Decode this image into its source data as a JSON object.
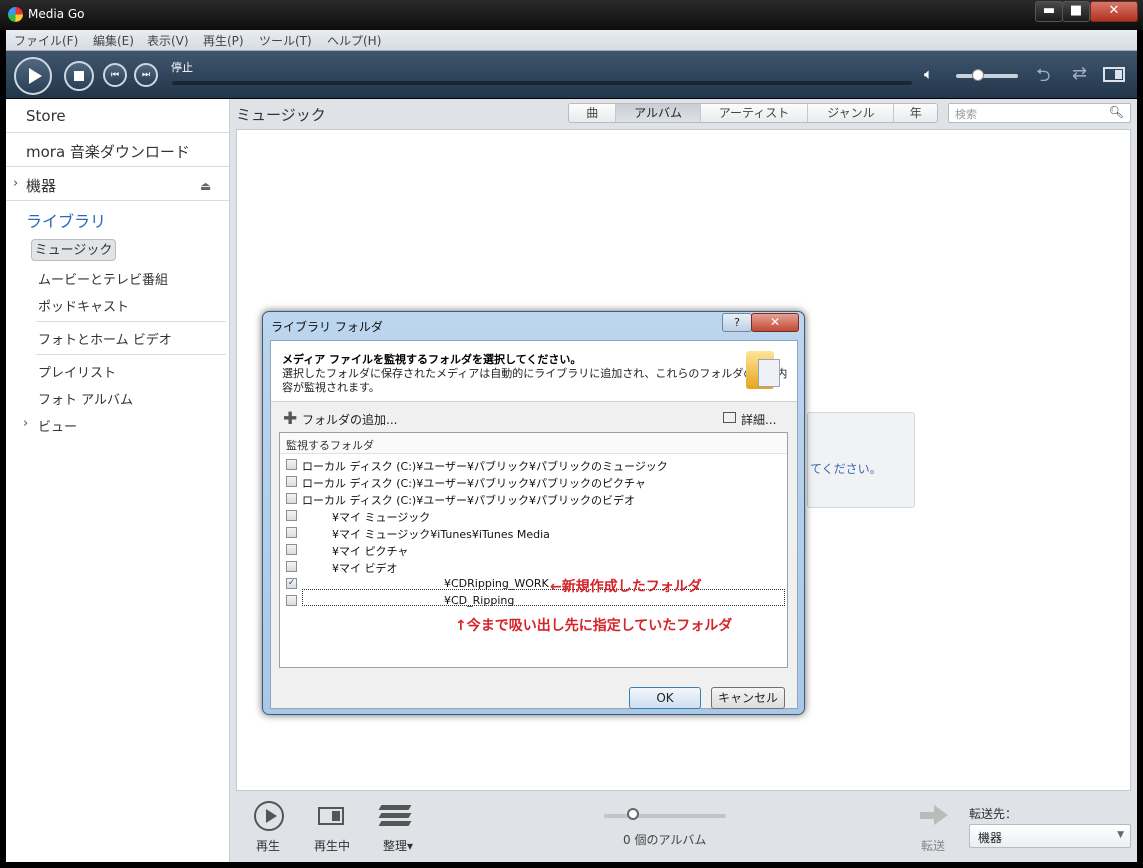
{
  "window": {
    "title": "Media Go",
    "minimize": "▬",
    "maximize": "■",
    "close": "✕"
  },
  "menu": [
    "ファイル(F)",
    "編集(E)",
    "表示(V)",
    "再生(P)",
    "ツール(T)",
    "ヘルプ(H)"
  ],
  "player": {
    "status": "停止",
    "prev": "⏮",
    "next": "⏭"
  },
  "sidebar": {
    "store": "Store",
    "mora": "mora 音楽ダウンロード",
    "devices": "機器",
    "devices_chevron": "›",
    "library": "ライブラリ",
    "music": "ミュージック",
    "movies": "ムービーとテレビ番組",
    "podcasts": "ポッドキャスト",
    "photos_home_video": "フォトとホーム ビデオ",
    "playlists": "プレイリスト",
    "photo_albums": "フォト アルバム",
    "views": "ビュー",
    "views_chevron": "›"
  },
  "content": {
    "title": "ミュージック",
    "tabs": [
      {
        "label": "曲",
        "active": false
      },
      {
        "label": "アルバム",
        "active": true
      },
      {
        "label": "アーティスト",
        "active": false
      },
      {
        "label": "ジャンル",
        "active": false
      },
      {
        "label": "年",
        "active": false
      }
    ],
    "search_placeholder": "検索",
    "hint_text": "てください。"
  },
  "bottom": {
    "play": "再生",
    "now_playing": "再生中",
    "organize": "整理▾",
    "album_count": "0 個のアルバム",
    "transfer": "転送",
    "destination_label": "転送先：",
    "destination_value": "機器"
  },
  "dialog": {
    "title": "ライブラリ フォルダ",
    "help": "?",
    "close": "✕",
    "heading": "メディア ファイルを監視するフォルダを選択してください。",
    "desc_line1": "選択したフォルダに保存されたメディアは自動的にライブラリに追加され、これらのフォルダの変更内",
    "desc_line2": "容が監視されます。",
    "add_folder": "フォルダの追加...",
    "details": "詳細...",
    "list_header": "監視するフォルダ",
    "folders": [
      {
        "label": "ローカル ディスク (C:)¥ユーザー¥パブリック¥パブリックのミュージック",
        "checked": false
      },
      {
        "label": "ローカル ディスク (C:)¥ユーザー¥パブリック¥パブリックのピクチャ",
        "checked": false
      },
      {
        "label": "ローカル ディスク (C:)¥ユーザー¥パブリック¥パブリックのビデオ",
        "checked": false
      },
      {
        "label": "¥マイ ミュージック",
        "checked": false
      },
      {
        "label": "¥マイ ミュージック¥iTunes¥iTunes Media",
        "checked": false
      },
      {
        "label": "¥マイ ピクチャ",
        "checked": false
      },
      {
        "label": "¥マイ ビデオ",
        "checked": false
      },
      {
        "label": "¥CDRipping_WORK",
        "checked": true
      },
      {
        "label": "¥CD_Ripping",
        "checked": false
      }
    ],
    "annotation_new": "←新規作成したフォルダ",
    "annotation_old": "↑今まで吸い出し先に指定していたフォルダ",
    "ok": "OK",
    "cancel": "キャンセル"
  }
}
